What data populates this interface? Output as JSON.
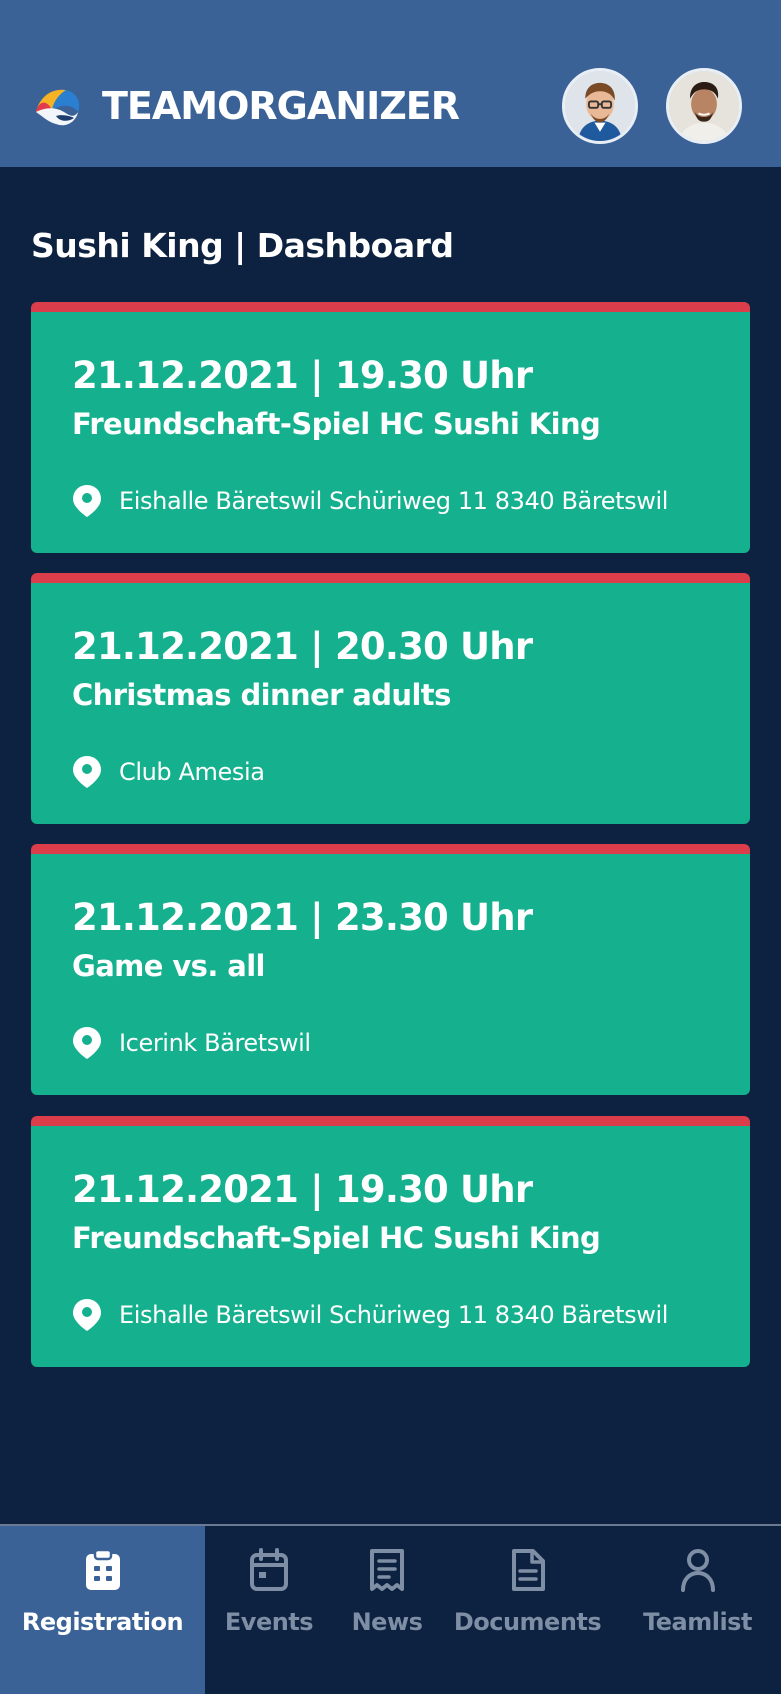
{
  "header": {
    "brand": "TEAMORGANIZER"
  },
  "page": {
    "title": "Sushi King | Dashboard"
  },
  "events": [
    {
      "date": "21.12.2021 | 19.30 Uhr",
      "title": "Freundschaft-Spiel HC Sushi King",
      "location": "Eishalle Bäretswil Schüriweg 11 8340 Bäretswil"
    },
    {
      "date": "21.12.2021 | 20.30 Uhr",
      "title": "Christmas dinner adults",
      "location": "Club Amesia"
    },
    {
      "date": "21.12.2021 | 23.30 Uhr",
      "title": "Game vs. all",
      "location": "Icerink Bäretswil"
    },
    {
      "date": "21.12.2021 | 19.30 Uhr",
      "title": "Freundschaft-Spiel HC Sushi King",
      "location": "Eishalle Bäretswil Schüriweg 11 8340 Bäretswil"
    }
  ],
  "nav": {
    "items": [
      {
        "label": "Registration",
        "icon": "clipboard-icon",
        "active": true
      },
      {
        "label": "Events",
        "icon": "calendar-icon",
        "active": false
      },
      {
        "label": "News",
        "icon": "receipt-icon",
        "active": false
      },
      {
        "label": "Documents",
        "icon": "document-icon",
        "active": false
      },
      {
        "label": "Teamlist",
        "icon": "person-icon",
        "active": false
      }
    ]
  },
  "colors": {
    "header_bg": "#3a6296",
    "page_bg": "#0d2240",
    "card_bg": "#15b08d",
    "card_accent": "#dc3d4a",
    "nav_inactive": "#7e8ea4"
  }
}
